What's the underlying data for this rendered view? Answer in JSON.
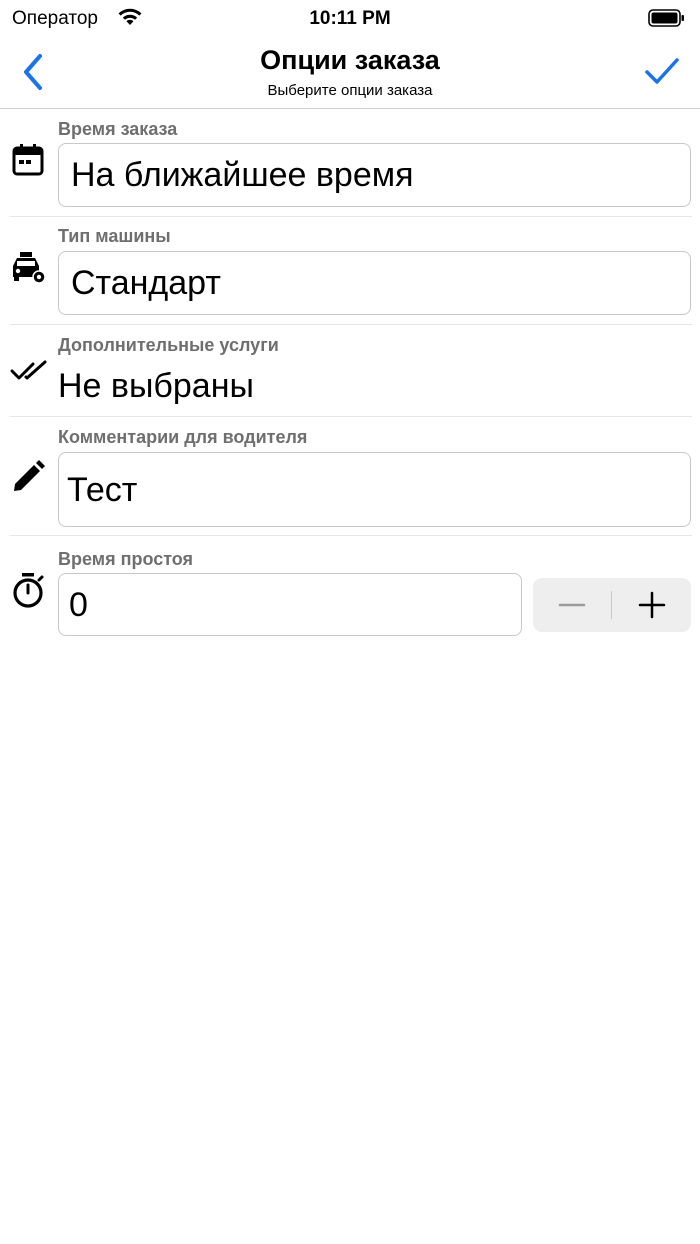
{
  "status_bar": {
    "carrier": "Оператор",
    "time": "10:11 PM",
    "icons": [
      "wifi-icon",
      "battery-icon"
    ]
  },
  "nav": {
    "title": "Опции заказа",
    "subtitle": "Выберите опции заказа",
    "back_icon": "chevron-left-icon",
    "done_icon": "checkmark-icon",
    "accent_color": "#1a73e8"
  },
  "form": {
    "order_time": {
      "label": "Время заказа",
      "value": "На ближайшее время",
      "icon": "calendar-icon"
    },
    "car_type": {
      "label": "Тип машины",
      "value": "Стандарт",
      "icon": "taxi-settings-icon"
    },
    "extra_services": {
      "label": "Дополнительные услуги",
      "value": "Не выбраны",
      "icon": "double-check-icon"
    },
    "driver_comment": {
      "label": "Комментарии для водителя",
      "value": "Тест",
      "icon": "pencil-icon"
    },
    "idle_time": {
      "label": "Время простоя",
      "value": "0",
      "icon": "stopwatch-icon",
      "stepper_icons": [
        "minus-icon",
        "plus-icon"
      ]
    }
  }
}
